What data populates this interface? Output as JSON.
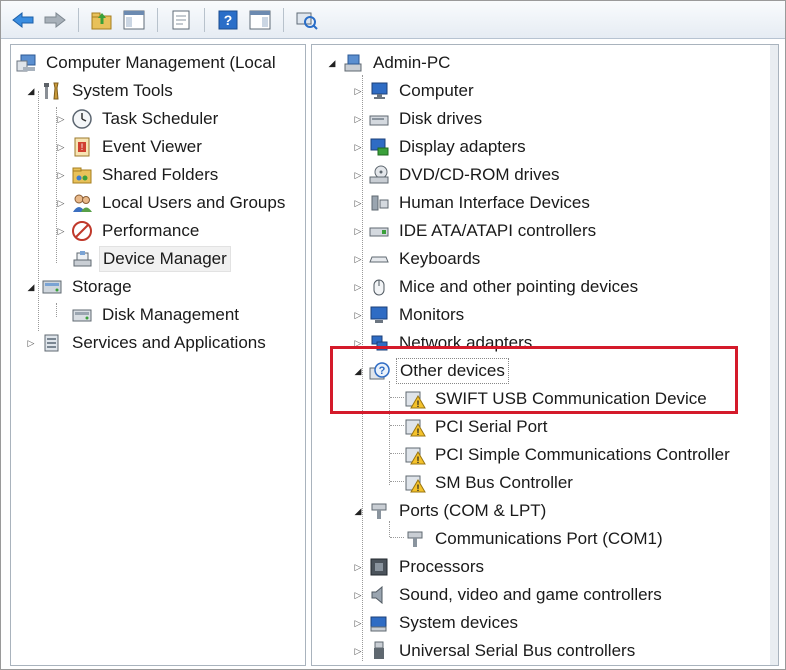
{
  "toolbar": {
    "buttons": [
      "back-icon",
      "forward-icon",
      "up-folder-icon",
      "show-hide-tree-icon",
      "properties-icon",
      "help-icon",
      "show-hide-action-pane-icon",
      "scan-hardware-icon"
    ]
  },
  "left_tree": {
    "root": "Computer Management (Local",
    "system_tools": "System Tools",
    "task_scheduler": "Task Scheduler",
    "event_viewer": "Event Viewer",
    "shared_folders": "Shared Folders",
    "local_users": "Local Users and Groups",
    "performance": "Performance",
    "device_manager": "Device Manager",
    "storage": "Storage",
    "disk_management": "Disk Management",
    "services": "Services and Applications"
  },
  "right_tree": {
    "root": "Admin-PC",
    "computer": "Computer",
    "disk_drives": "Disk drives",
    "display_adapters": "Display adapters",
    "dvd": "DVD/CD-ROM drives",
    "hid": "Human Interface Devices",
    "ide": "IDE ATA/ATAPI controllers",
    "keyboards": "Keyboards",
    "mice": "Mice and other pointing devices",
    "monitors": "Monitors",
    "network": "Network adapters",
    "other_devices": "Other devices",
    "swift_usb": "SWIFT USB Communication Device",
    "pci_serial": "PCI Serial Port",
    "pci_simple": "PCI Simple Communications Controller",
    "sm_bus": "SM Bus Controller",
    "ports": "Ports (COM & LPT)",
    "com1": "Communications Port (COM1)",
    "processors": "Processors",
    "sound": "Sound, video and game controllers",
    "system_devices": "System devices",
    "usb": "Universal Serial Bus controllers"
  },
  "colors": {
    "highlight": "#d41a2a",
    "selected_bg": "#f1f1f1"
  }
}
